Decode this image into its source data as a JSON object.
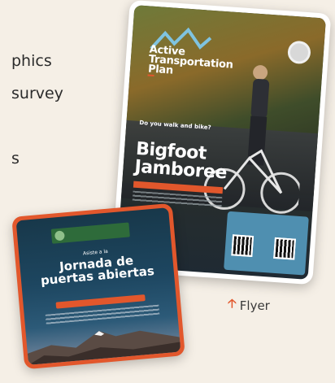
{
  "text": {
    "line1": "phics",
    "line2": "survey",
    "line3": "s"
  },
  "flyer": {
    "plan_title_1": "Active",
    "plan_title_2": "Transportation",
    "plan_title_3": "Plan",
    "question_1": "Do you walk and bike?",
    "event_1": "Bigfoot",
    "event_2": "Jamboree",
    "caption": "Flyer",
    "arrow_icon": "arrow-up-icon"
  },
  "card2": {
    "small": "Asiste a la",
    "title_1": "Jornada de",
    "title_2": "puertas abiertas"
  },
  "colors": {
    "accent": "#e2572c",
    "background": "#f5efe6"
  }
}
